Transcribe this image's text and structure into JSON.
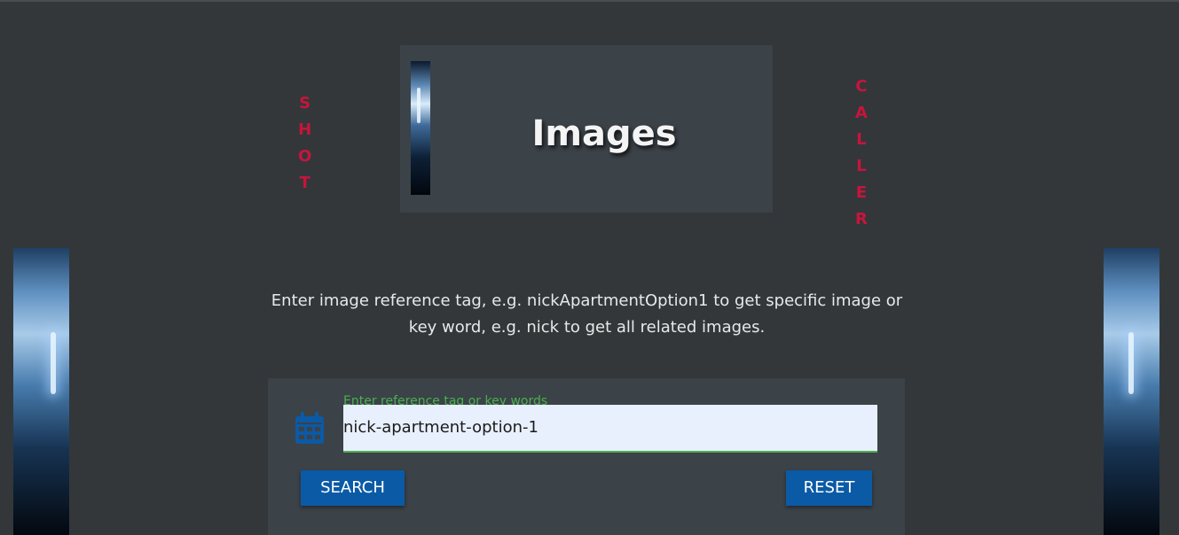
{
  "header": {
    "title": "Images",
    "left_vertical_word": [
      "S",
      "H",
      "O",
      "T"
    ],
    "right_vertical_word": [
      "C",
      "A",
      "L",
      "L",
      "E",
      "R"
    ],
    "accent_color": "#c8143c"
  },
  "instructions": {
    "line1": "Enter image reference tag, e.g. nickApartmentOption1 to get specific image or",
    "line2": "key word, e.g. nick to get all related images."
  },
  "search": {
    "icon": "calendar-icon",
    "label": "Enter reference tag or key words",
    "value": "nick-apartment-option-1",
    "search_label": "SEARCH",
    "reset_label": "RESET",
    "button_color": "#0b5aa6",
    "focus_color": "#4caf50"
  }
}
